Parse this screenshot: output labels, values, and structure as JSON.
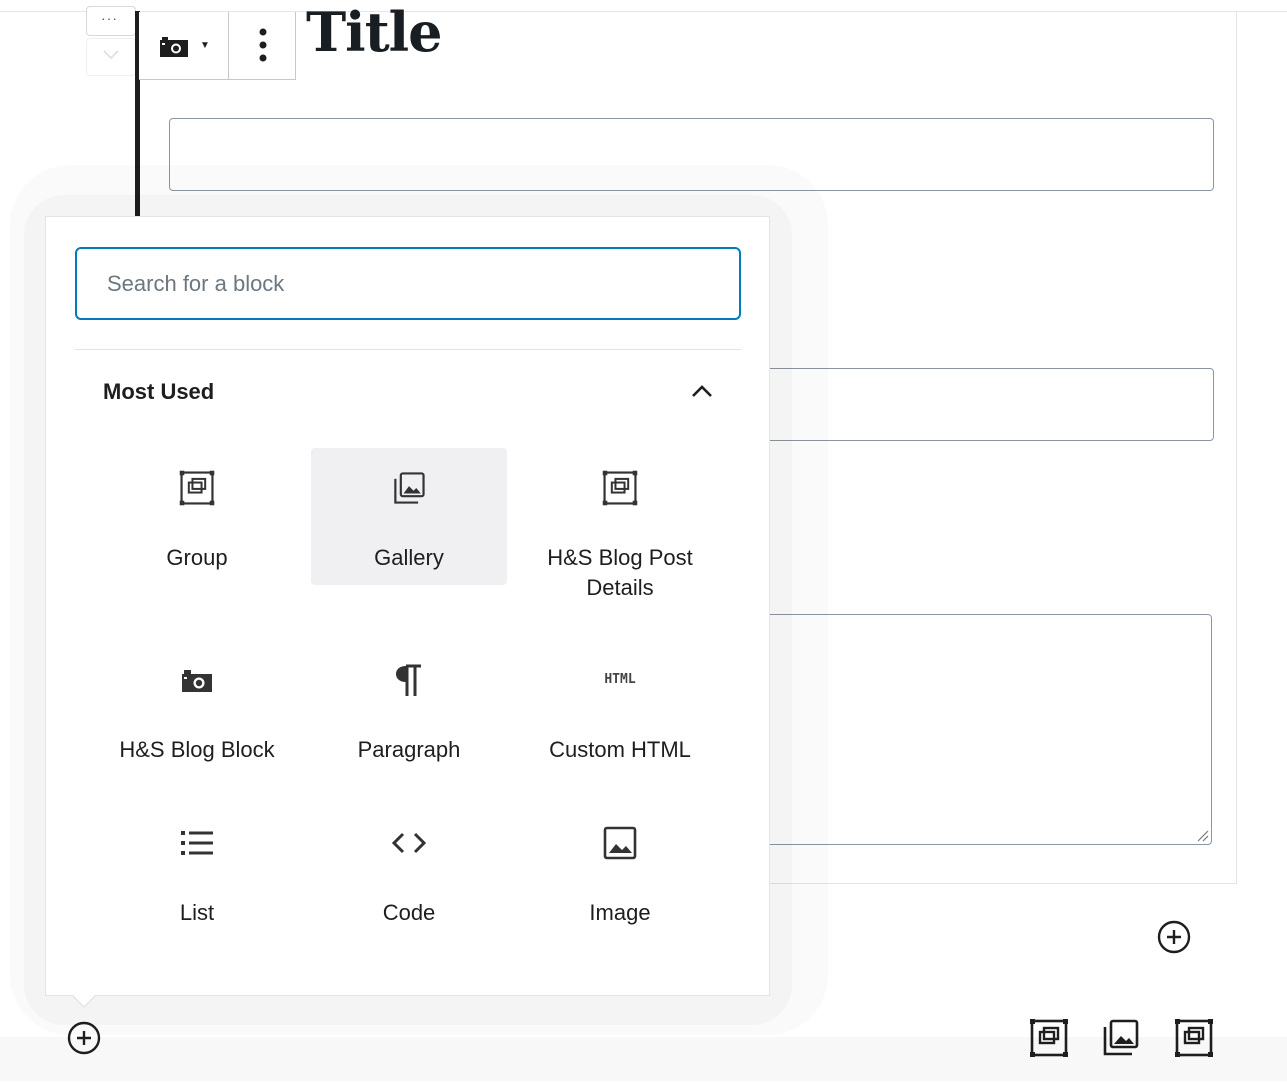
{
  "editor": {
    "title": "Title",
    "mover": {
      "more_glyph": "···"
    }
  },
  "inserter": {
    "search_placeholder": "Search for a block",
    "panel_title": "Most Used",
    "blocks": [
      {
        "label": "Group",
        "icon": "group-icon"
      },
      {
        "label": "Gallery",
        "icon": "gallery-icon"
      },
      {
        "label": "H&S Blog Post Details",
        "icon": "group-icon"
      },
      {
        "label": "H&S Blog Block",
        "icon": "camera-icon"
      },
      {
        "label": "Paragraph",
        "icon": "paragraph-icon"
      },
      {
        "label": "Custom HTML",
        "icon": "html-icon"
      },
      {
        "label": "List",
        "icon": "list-icon"
      },
      {
        "label": "Code",
        "icon": "code-icon"
      },
      {
        "label": "Image",
        "icon": "image-icon"
      }
    ],
    "html_icon_text": "HTML"
  },
  "colors": {
    "accent": "#007cba",
    "active_item_bg": "#f0f0f3",
    "text": "#1e1e1e"
  }
}
